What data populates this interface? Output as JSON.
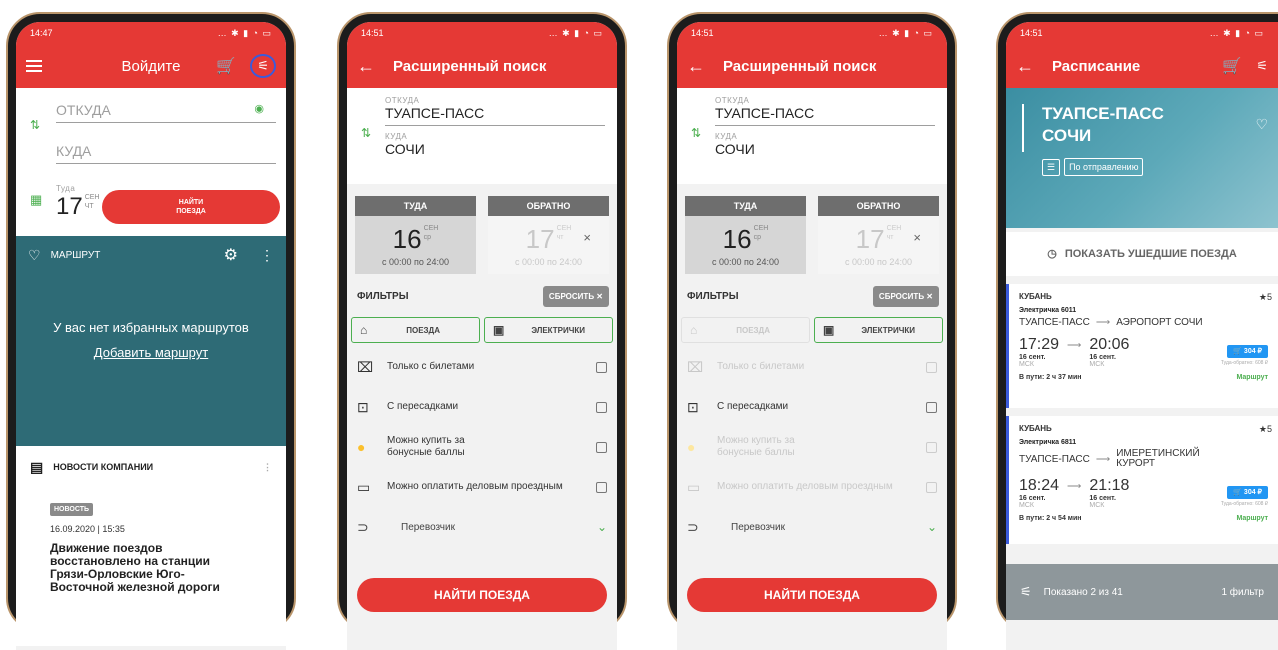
{
  "screen1": {
    "status_time": "14:47",
    "title": "Войдите",
    "from_placeholder": "ОТКУДА",
    "to_placeholder": "КУДА",
    "date_label": "Туда",
    "date_day": "17",
    "date_month": "СЕН",
    "date_weekday": "ЧТ",
    "find_button": "НАЙТИ ПОЕЗДА",
    "route_title": "МАРШРУТ",
    "empty_text": "У вас нет избранных маршрутов",
    "add_route_link": "Добавить маршрут",
    "news_title": "НОВОСТИ КОМПАНИИ",
    "news_badge": "НОВОСТЬ",
    "news_date": "16.09.2020 | 15:35",
    "news_headline": "Движение поездов восстановлено на станции Грязи-Орловские Юго-Восточной железной дороги"
  },
  "search_common": {
    "title": "Расширенный поиск",
    "from_label": "ОТКУДА",
    "from_value": "ТУАПСЕ-ПАСС",
    "to_label": "КУДА",
    "to_value": "СОЧИ",
    "there_header": "ТУДА",
    "back_header": "ОБРАТНО",
    "there_day": "16",
    "there_month": "СЕН",
    "there_weekday": "ср",
    "back_day": "17",
    "back_month": "СЕН",
    "back_weekday": "чт",
    "time_range": "с 00:00 по 24:00",
    "filters_title": "ФИЛЬТРЫ",
    "reset_button": "СБРОСИТЬ ✕",
    "chip_trains": "ПОЕЗДА",
    "chip_electric": "ЭЛЕКТРИЧКИ",
    "opt_tickets": "Только с билетами",
    "opt_transfers": "С пересадками",
    "opt_bonus": "Можно купить за бонусные баллы",
    "opt_business": "Можно оплатить деловым проездным",
    "carrier_label": "Перевозчик",
    "find_button": "НАЙТИ ПОЕЗДА"
  },
  "screen2": {
    "status_time": "14:51"
  },
  "screen3": {
    "status_time": "14:51"
  },
  "screen4": {
    "status_time": "14:51",
    "title": "Расписание",
    "from_station": "ТУАПСЕ-ПАСС",
    "to_station": "СОЧИ",
    "sort_label": "По отправлению",
    "show_departed": "ПОКАЗАТЬ УШЕДШИЕ ПОЕЗДА",
    "cards": [
      {
        "carrier": "КУБАНЬ",
        "rating": "5",
        "train": "Электричка 6011",
        "from": "ТУАПСЕ-ПАСС",
        "to": "АЭРОПОРТ СОЧИ",
        "dep_time": "17:29",
        "arr_time": "20:06",
        "dep_date": "16 сент.",
        "arr_date": "16 сент.",
        "tz": "МСК",
        "price": "304 ₽",
        "roundtrip": "Туда-обратно: 608 ₽",
        "duration": "В пути: 2 ч 37 мин",
        "route_link": "Маршрут"
      },
      {
        "carrier": "КУБАНЬ",
        "rating": "5",
        "train": "Электричка 6811",
        "from": "ТУАПСЕ-ПАСС",
        "to": "ИМЕРЕТИНСКИЙ КУРОРТ",
        "dep_time": "18:24",
        "arr_time": "21:18",
        "dep_date": "16 сент.",
        "arr_date": "16 сент.",
        "tz": "МСК",
        "price": "304 ₽",
        "roundtrip": "Туда-обратно: 608 ₽",
        "duration": "В пути: 2 ч 54 мин",
        "route_link": "Маршрут"
      }
    ],
    "shown_count": "Показано 2 из 41",
    "filter_count": "1 фильтр"
  },
  "colors": {
    "brand_red": "#e53935",
    "teal": "#2e6b76",
    "accent_green": "#4caf50",
    "price_blue": "#2196f3"
  }
}
